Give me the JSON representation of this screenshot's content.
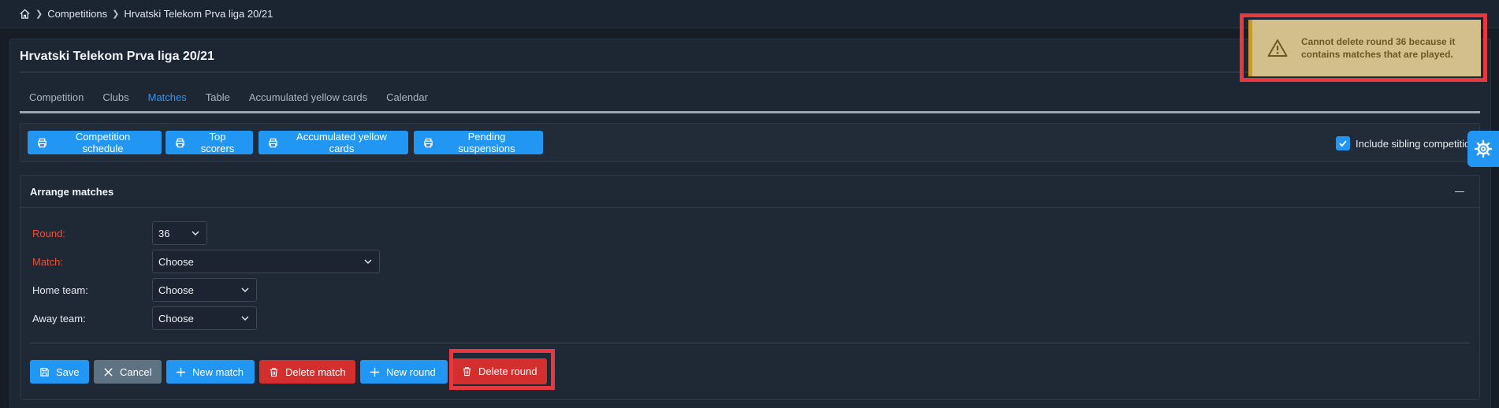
{
  "breadcrumb": {
    "items": [
      "Competitions",
      "Hrvatski Telekom Prva liga 20/21"
    ]
  },
  "page_title": "Hrvatski Telekom Prva liga 20/21",
  "tabs": [
    {
      "label": "Competition"
    },
    {
      "label": "Clubs"
    },
    {
      "label": "Matches",
      "active": true
    },
    {
      "label": "Table"
    },
    {
      "label": "Accumulated yellow cards"
    },
    {
      "label": "Calendar"
    }
  ],
  "toolbar": {
    "print_buttons": [
      "Competition schedule",
      "Top scorers",
      "Accumulated yellow cards",
      "Pending suspensions"
    ],
    "include_sibling_label": "Include sibling competitions",
    "include_sibling_checked": true
  },
  "panel": {
    "title": "Arrange matches",
    "fields": {
      "round_label": "Round:",
      "round_value": "36",
      "match_label": "Match:",
      "match_value": "Choose",
      "home_label": "Home team:",
      "home_value": "Choose",
      "away_label": "Away team:",
      "away_value": "Choose"
    },
    "actions": {
      "save": "Save",
      "cancel": "Cancel",
      "new_match": "New match",
      "delete_match": "Delete match",
      "new_round": "New round",
      "delete_round": "Delete round"
    }
  },
  "toast": {
    "message": "Cannot delete round 36 because it contains matches that are played."
  },
  "colors": {
    "accent": "#2196f3",
    "danger": "#d32f2f",
    "warning_bg": "#d2bf8c",
    "highlight": "#e8383f"
  },
  "icons": [
    "home-icon",
    "chevron-right-icon",
    "printer-icon",
    "check-icon",
    "gear-icon",
    "minus-icon",
    "chevron-down-icon",
    "save-icon",
    "close-icon",
    "plus-icon",
    "trash-icon",
    "warning-icon"
  ]
}
